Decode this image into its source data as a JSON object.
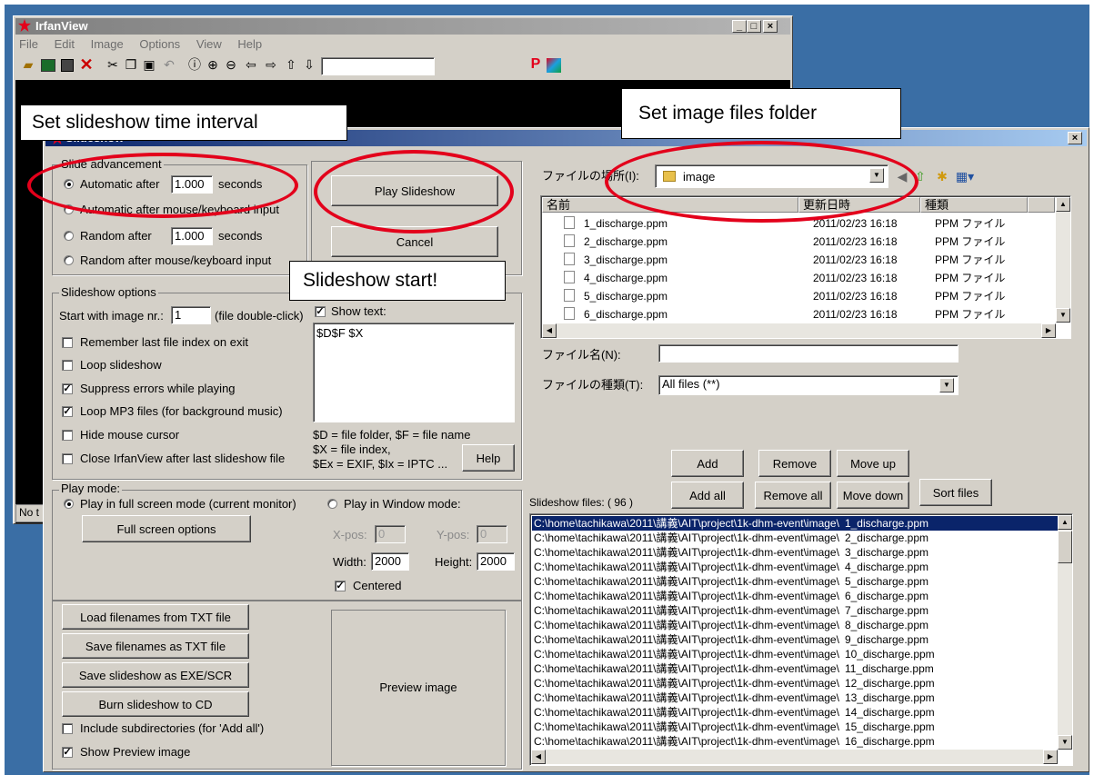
{
  "irfan": {
    "title": "IrfanView",
    "menu": [
      "File",
      "Edit",
      "Image",
      "Options",
      "View",
      "Help"
    ],
    "status_left": "No t"
  },
  "slideshow": {
    "title": "Slideshow",
    "close": "×",
    "advancement": {
      "label": "Slide advancement",
      "auto_after": "Automatic after",
      "auto_value": "1.000",
      "seconds": "seconds",
      "auto_input": "Automatic after mouse/keyboard input",
      "random_after": "Random  after",
      "random_value": "1.000",
      "random_seconds": "seconds",
      "random_input": "Random  after mouse/keyboard input"
    },
    "play_button": "Play Slideshow",
    "cancel_button": "Cancel",
    "options": {
      "label": "Slideshow options",
      "start_label": "Start with image nr.:",
      "start_value": "1",
      "start_hint": "(file double-click)",
      "remember": "Remember last file index on exit",
      "loop": "Loop slideshow",
      "suppress": "Suppress errors while playing",
      "loop_mp3": "Loop MP3 files (for background music)",
      "hide_cursor": "Hide mouse cursor",
      "close_after": "Close IrfanView after last slideshow file",
      "show_text": "Show text:",
      "text_value": "$D$F $X",
      "legend1": "$D = file folder, $F = file name",
      "legend2": "$X = file index,",
      "legend3": "$Ex = EXIF, $Ix = IPTC ...",
      "help_button": "Help"
    },
    "play_mode": {
      "label": "Play mode:",
      "fullscreen": "Play in full screen mode (current monitor)",
      "window": "Play in Window mode:",
      "fs_options": "Full screen options",
      "xpos_label": "X-pos:",
      "xpos_value": "0",
      "ypos_label": "Y-pos:",
      "ypos_value": "0",
      "width_label": "Width:",
      "width_value": "2000",
      "height_label": "Height:",
      "height_value": "2000",
      "centered": "Centered"
    },
    "bottom": {
      "load_txt": "Load filenames from TXT file",
      "save_txt": "Save filenames as TXT file",
      "save_exe": "Save slideshow as  EXE/SCR",
      "burn": "Burn slideshow to CD",
      "include_sub": "Include subdirectories (for 'Add all')",
      "show_preview": "Show Preview image",
      "preview": "Preview image"
    },
    "browser": {
      "location_label": "ファイルの場所(I):",
      "location_value": "image",
      "col_name": "名前",
      "col_date": "更新日時",
      "col_type": "種類",
      "files": [
        {
          "name": "1_discharge.ppm",
          "date": "2011/02/23 16:18",
          "type": "PPM ファイル"
        },
        {
          "name": "2_discharge.ppm",
          "date": "2011/02/23 16:18",
          "type": "PPM ファイル"
        },
        {
          "name": "3_discharge.ppm",
          "date": "2011/02/23 16:18",
          "type": "PPM ファイル"
        },
        {
          "name": "4_discharge.ppm",
          "date": "2011/02/23 16:18",
          "type": "PPM ファイル"
        },
        {
          "name": "5_discharge.ppm",
          "date": "2011/02/23 16:18",
          "type": "PPM ファイル"
        },
        {
          "name": "6_discharge.ppm",
          "date": "2011/02/23 16:18",
          "type": "PPM ファイル"
        }
      ],
      "filename_label": "ファイル名(N):",
      "filename_value": "",
      "filetype_label": "ファイルの種類(T):",
      "filetype_value": "All files (**)"
    },
    "list_buttons": {
      "add": "Add",
      "remove": "Remove",
      "move_up": "Move up",
      "add_all": "Add all",
      "remove_all": "Remove all",
      "move_down": "Move down",
      "sort": "Sort files"
    },
    "list_label": "Slideshow files:  ( 96 )",
    "list_prefix": "C:\\home\\tachikawa\\2011\\講義\\AIT\\project\\1k-dhm-event\\image\\",
    "list_files": [
      "1_discharge.ppm",
      "2_discharge.ppm",
      "3_discharge.ppm",
      "4_discharge.ppm",
      "5_discharge.ppm",
      "6_discharge.ppm",
      "7_discharge.ppm",
      "8_discharge.ppm",
      "9_discharge.ppm",
      "10_discharge.ppm",
      "11_discharge.ppm",
      "12_discharge.ppm",
      "13_discharge.ppm",
      "14_discharge.ppm",
      "15_discharge.ppm",
      "16_discharge.ppm"
    ]
  },
  "callouts": {
    "interval": "Set slideshow time interval",
    "folder": "Set image files folder",
    "start": "Slideshow start!"
  },
  "colors": {
    "ring": "#e3001b",
    "selection": "#0a246a",
    "desktop": "#3a6ea5"
  },
  "icons": [
    "open-folder-icon",
    "slideshow-icon",
    "save-icon",
    "delete-icon",
    "cut-icon",
    "copy-icon",
    "paste-icon",
    "undo-icon",
    "info-icon",
    "zoom-in-icon",
    "zoom-out-icon",
    "arrow-left-icon",
    "arrow-right-icon",
    "first-icon",
    "last-icon",
    "paint-icon",
    "palette-icon",
    "folder-icon",
    "back-icon",
    "up-folder-icon",
    "new-folder-icon",
    "view-menu-icon",
    "file-icon"
  ]
}
